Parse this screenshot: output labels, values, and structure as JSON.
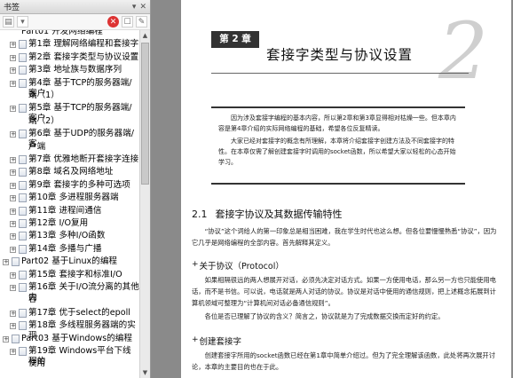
{
  "panel": {
    "title": "书签",
    "header_icons": [
      "options-icon",
      "close-icon"
    ],
    "items": [
      {
        "label": "Part01 开发网络编程",
        "level": 0,
        "expander": false,
        "cut": true
      },
      {
        "label": "第1章 理解网络编程和套接字",
        "level": 1,
        "expander": true
      },
      {
        "label": "第2章 套接字类型与协议设置",
        "level": 1,
        "expander": true,
        "selected": true
      },
      {
        "label": "第3章 地址族与数据序列",
        "level": 1,
        "expander": true
      },
      {
        "label": "第4章 基于TCP的服务器端/客户",
        "level": 1,
        "expander": true
      },
      {
        "label": "端（1）",
        "level": 1,
        "expander": false,
        "cont": true
      },
      {
        "label": "第5章 基于TCP的服务器端/客户",
        "level": 1,
        "expander": true
      },
      {
        "label": "端（2）",
        "level": 1,
        "expander": false,
        "cont": true
      },
      {
        "label": "第6章 基于UDP的服务器端/客",
        "level": 1,
        "expander": true
      },
      {
        "label": "户端",
        "level": 1,
        "expander": false,
        "cont": true
      },
      {
        "label": "第7章 优雅地断开套接字连接",
        "level": 1,
        "expander": true
      },
      {
        "label": "第8章 域名及网络地址",
        "level": 1,
        "expander": true
      },
      {
        "label": "第9章 套接字的多种可选项",
        "level": 1,
        "expander": true
      },
      {
        "label": "第10章 多进程服务器端",
        "level": 1,
        "expander": true
      },
      {
        "label": "第11章 进程间通信",
        "level": 1,
        "expander": true
      },
      {
        "label": "第12章 I/O复用",
        "level": 1,
        "expander": true
      },
      {
        "label": "第13章 多种I/O函数",
        "level": 1,
        "expander": true
      },
      {
        "label": "第14章 多播与广播",
        "level": 1,
        "expander": true
      },
      {
        "label": "Part02 基于Linux的编程",
        "level": 0,
        "expander": true
      },
      {
        "label": "第15章 套接字和标准I/O",
        "level": 1,
        "expander": true
      },
      {
        "label": "第16章 关于I/O流分离的其他内",
        "level": 1,
        "expander": true
      },
      {
        "label": "容",
        "level": 1,
        "expander": false,
        "cont": true
      },
      {
        "label": "第17章 优于select的epoll",
        "level": 1,
        "expander": true
      },
      {
        "label": "第18章 多线程服务器端的实现",
        "level": 1,
        "expander": true
      },
      {
        "label": "Part03 基于Windows的编程",
        "level": 0,
        "expander": true
      },
      {
        "label": "第19章 Windows平台下线程的",
        "level": 1,
        "expander": true
      },
      {
        "label": "使用",
        "level": 1,
        "expander": false,
        "cont": true
      }
    ]
  },
  "page": {
    "chapter_label": "第 2 章",
    "chapter_number": "2",
    "chapter_title": "套接字类型与协议设置",
    "abstract": [
      "因为涉及套接字编程的基本内容，所以第2章和第3章显得相对枯燥一些。但本章内容是第4章介绍的实际网络编程的基础，希望各位反复精读。",
      "大家已经对套接字的概念有所理解，本章将介绍套接字创建方法及不同套接字的特性。在本章仅需了解创建套接字时调用的socket函数，所以希望大家以轻松的心态开始学习。"
    ],
    "section": {
      "number": "2.1",
      "title": "套接字协议及其数据传输特性"
    },
    "para1": "“协议”这个词给人的第一印象总是相当困难，我在学生时代也这么想。但各位要慢慢熟悉“协议”，因为它几乎是网络编程的全部内容。首先解释其定义。",
    "subhead1": {
      "plus": "+",
      "title": "关于协议（Protocol）"
    },
    "para2": "如果相隔很远的两人想展开对话，必须先决定对话方式。如果一方使用电话，那么另一方也只能使用电话，而不是书信。可以说，电话就是两人对话的协议。协议是对话中使用的通信规则，把上述概念拓展到计算机领域可整理为“计算机间对话必备通信规则”。",
    "para3": "各位是否已理解了协议的含义？简言之，协议就是为了完成数据交换而定好的约定。",
    "subhead2": {
      "plus": "+",
      "title": "创建套接字"
    },
    "para4": "创建套接字所用的socket函数已经在第1章中简单介绍过。但为了完全理解该函数，此处将再次展开讨论，本章的主要目的也在于此。"
  }
}
